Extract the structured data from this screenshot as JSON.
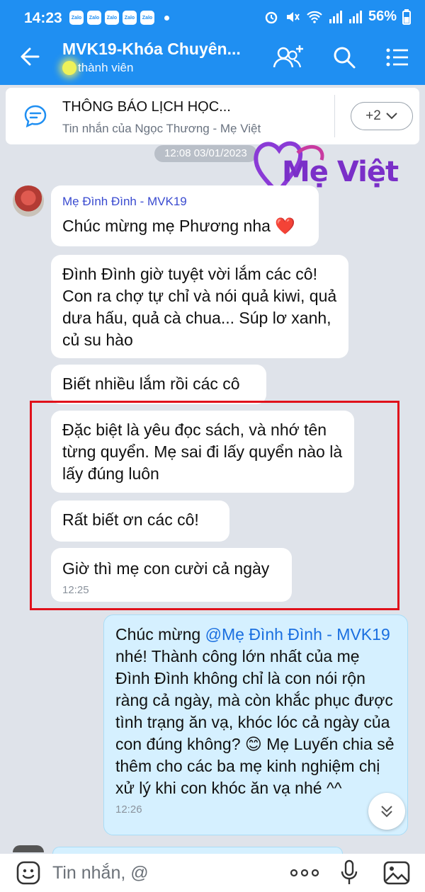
{
  "status_bar": {
    "time": "14:23",
    "battery": "56%",
    "app_icon_text": "Zalo"
  },
  "header": {
    "title": "MVK19-Khóa Chuyên...",
    "members": "thành viên"
  },
  "pinned": {
    "title": "THÔNG BÁO LỊCH HỌC...",
    "subtitle": "Tin nhắn của Ngọc Thương - Mẹ Việt",
    "more": "+2"
  },
  "date_separator": "12:08 03/01/2023",
  "watermark": "Mẹ Việt",
  "messages": {
    "sender": "Mẹ Đình Đình - MVK19",
    "m1": "Chúc mừng mẹ Phương nha ❤️",
    "m2": "Đình Đình giờ tuyệt vời lắm các cô! Con ra chợ tự chỉ và nói quả kiwi, quả dưa hấu, quả cà chua... Súp lơ xanh, củ su hào",
    "m3": "Biết nhiều lắm rồi các cô",
    "m4": "Đặc biệt là yêu đọc sách, và nhớ tên từng quyển. Mẹ sai đi lấy quyển nào là lấy đúng luôn",
    "m5": "Rất biết ơn các cô!",
    "m6": "Giờ thì mẹ con cười cả ngày",
    "m6_time": "12:25"
  },
  "reply": {
    "prefix": "Chúc mừng ",
    "mention": "@Mẹ Đình Đình - MVK19",
    "body": " nhé! Thành công lớn nhất của mẹ Đình Đình không chỉ là con nói rộn ràng cả ngày, mà còn khắc phục được tình trạng ăn vạ, khóc lóc cả ngày của con đúng không? 😊 Mẹ Luyến chia sẻ thêm cho các ba mẹ kinh nghiệm chị xử lý khi con khóc ăn vạ nhé ^^",
    "time": "12:26"
  },
  "input": {
    "placeholder": "Tin nhắn, @"
  },
  "colors": {
    "header_blue": "#1f8ff2",
    "sender_blue": "#3a4bd0",
    "highlight_red": "#e0111b",
    "outgoing_bubble": "#d5f0ff",
    "watermark_purple": "#7a2fc8"
  }
}
